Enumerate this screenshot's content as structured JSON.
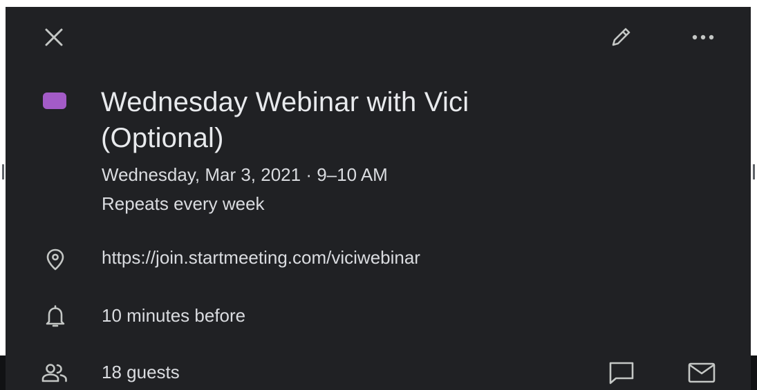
{
  "event": {
    "title_line1": "Wednesday Webinar with Vici",
    "title_line2": "(Optional)",
    "datetime": "Wednesday, Mar 3, 2021 · 9–10 AM",
    "recurrence": "Repeats every week",
    "location": "https://join.startmeeting.com/viciwebinar",
    "reminder": "10 minutes before",
    "guests": "18 guests",
    "calendar_color": "#a35bc7"
  },
  "icons": {
    "close": "close-icon",
    "edit": "pencil-icon",
    "more": "more-horizontal-icon",
    "location": "location-pin-icon",
    "reminder": "bell-icon",
    "guests": "people-icon",
    "chat": "chat-icon",
    "email": "mail-icon"
  }
}
